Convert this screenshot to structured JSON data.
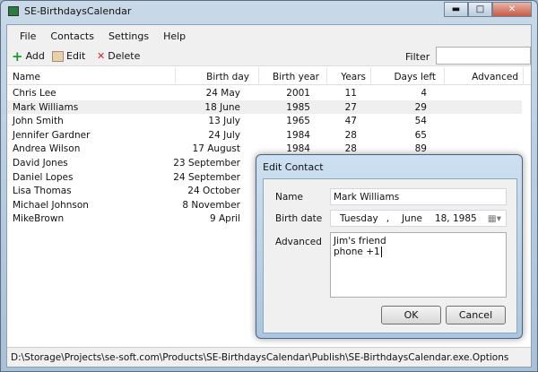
{
  "window": {
    "title": "SE-BirthdaysCalendar"
  },
  "menu": [
    "File",
    "Contacts",
    "Settings",
    "Help"
  ],
  "toolbar": {
    "add": "Add",
    "edit": "Edit",
    "delete": "Delete",
    "filter_label": "Filter",
    "filter_value": ""
  },
  "columns": [
    "Name",
    "Birth day",
    "Birth year",
    "Years",
    "Days left",
    "Advanced"
  ],
  "rows": [
    {
      "name": "Chris Lee",
      "day": "24 May",
      "year": "2001",
      "years": "11",
      "left": "4",
      "adv": ""
    },
    {
      "name": "Mark Williams",
      "day": "18 June",
      "year": "1985",
      "years": "27",
      "left": "29",
      "adv": ""
    },
    {
      "name": "John Smith",
      "day": "13 July",
      "year": "1965",
      "years": "47",
      "left": "54",
      "adv": ""
    },
    {
      "name": "Jennifer Gardner",
      "day": "24 July",
      "year": "1984",
      "years": "28",
      "left": "65",
      "adv": ""
    },
    {
      "name": "Andrea Wilson",
      "day": "17 August",
      "year": "1984",
      "years": "28",
      "left": "89",
      "adv": ""
    },
    {
      "name": "David Jones",
      "day": "23 September",
      "year": "",
      "years": "",
      "left": "",
      "adv": ""
    },
    {
      "name": "Daniel Lopes",
      "day": "24 September",
      "year": "",
      "years": "",
      "left": "",
      "adv": ""
    },
    {
      "name": "Lisa Thomas",
      "day": "24 October",
      "year": "",
      "years": "",
      "left": "",
      "adv": ""
    },
    {
      "name": "Michael Johnson",
      "day": "8 November",
      "year": "",
      "years": "",
      "left": "",
      "adv": ""
    },
    {
      "name": "MikeBrown",
      "day": "9 April",
      "year": "",
      "years": "",
      "left": "",
      "adv": ""
    }
  ],
  "selected_row": 1,
  "status": "D:\\Storage\\Projects\\se-soft.com\\Products\\SE-BirthdaysCalendar\\Publish\\SE-BirthdaysCalendar.exe.Options",
  "dialog": {
    "title": "Edit Contact",
    "name_label": "Name",
    "name_value": "Mark Williams",
    "birth_label": "Birth date",
    "birth_weekday": "Tuesday",
    "birth_month": "June",
    "birth_dayyear": "18, 1985",
    "advanced_label": "Advanced",
    "advanced_line1": "Jim's friend",
    "advanced_line2": "phone +1",
    "ok": "OK",
    "cancel": "Cancel"
  }
}
